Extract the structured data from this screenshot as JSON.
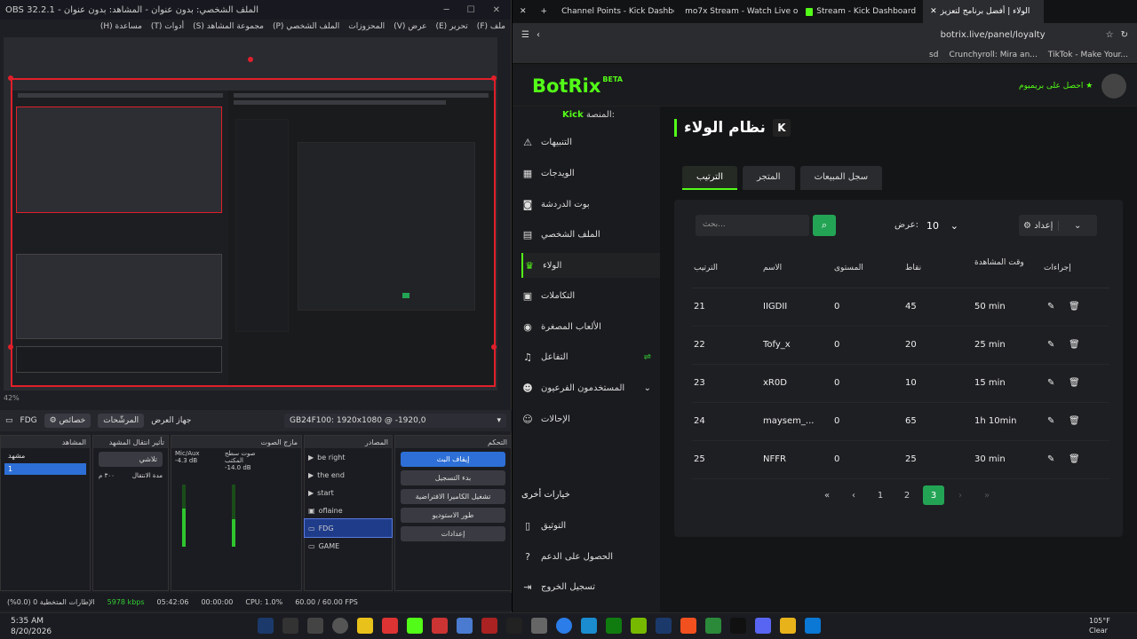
{
  "obs": {
    "title": "OBS 32.2.1 - الملف الشخصي: بدون عنوان - المشاهد: بدون عنوان",
    "menu": [
      "ملف (F)",
      "تحرير (E)",
      "عرض (V)",
      "المحزوزات",
      "الملف الشخصي (P)",
      "مجموعة المشاهد (S)",
      "أدوات (T)",
      "مساعدة (H)"
    ],
    "zoom": "42%",
    "source_name": "FDG",
    "properties_btn": "خصائص",
    "filters_btn": "المرشّحات",
    "device_label": "جهاز العرض",
    "device_value": "GB24F100: 1920x1080 @ -1920,0",
    "docks": {
      "scenes": "المشاهد",
      "transition": "تأثير انتقال المشهد",
      "mixer": "مازج الصوت",
      "sources": "المصادر",
      "controls": "التحكم"
    },
    "scenes": [
      "مشهد",
      "1"
    ],
    "transition_value": "تلاشي",
    "duration_label": "مدة الانتقال",
    "duration_value": "٣٠٠ م",
    "mixer": [
      {
        "name": "Mic/Aux",
        "db": "-4.3 dB",
        "level": 0.62
      },
      {
        "name": "صوت سطح المكتب",
        "db": "-14.0 dB",
        "level": 0.45
      }
    ],
    "sources": [
      "be right",
      "the end",
      "start",
      "oflaine",
      "FDG",
      "GAME"
    ],
    "controls": [
      "إيقاف البث",
      "بدء التسجيل",
      "تشغيل الكاميرا الافتراضية",
      "طور الاستوديو",
      "إعدادات"
    ],
    "status": {
      "dropped": "الإطارات المتخطية 0 (0.0%)",
      "kbps": "5978 kbps",
      "live": "05:42:06",
      "rec": "00:00:00",
      "cpu": "CPU: 1.0%",
      "fps": "60.00 / 60.00 FPS"
    }
  },
  "browser": {
    "tabs": [
      "Channel Points - Kick Dashbo",
      "mo7x Stream - Watch Live on",
      "Stream - Kick Dashboard",
      "الولاء | أفضل برنامج لتعزيز"
    ],
    "url": "botrix.live/panel/loyalty",
    "bookmarks": [
      "sd",
      "Crunchyroll: Mira an...",
      "TikTok - Make Your..."
    ]
  },
  "botrix": {
    "logo": "BotRix",
    "beta": "BETA",
    "premium": "احصل على بريميوم",
    "platform_label": "المنصة:",
    "platform_value": "Kick",
    "sidebar": [
      "التنبيهات",
      "الويدجات",
      "بوت الدردشة",
      "الملف الشخصي",
      "الولاء",
      "التكاملات",
      "الألعاب المصغرة",
      "التفاعل",
      "المستخدمون الفرعيون",
      "الإحالات"
    ],
    "other_options": "خيارات أخرى",
    "sidebar_bottom": [
      "التوثيق",
      "الحصول على الدعم",
      "تسجيل الخروج"
    ],
    "page_title": "نظام الولاء",
    "tabs": [
      "الترتيب",
      "المتجر",
      "سجل المبيعات"
    ],
    "search_placeholder": "بحث...",
    "show_label": "عرض:",
    "show_value": "10",
    "settings_btn": "إعداد",
    "columns": [
      "الترتيب",
      "الاسم",
      "المستوى",
      "نقاط",
      "وقت المشاهدة",
      "إجراءات"
    ],
    "rows": [
      {
        "rank": "21",
        "name": "IIGDII",
        "level": "0",
        "points": "45",
        "time": "50 min"
      },
      {
        "rank": "22",
        "name": "Tofy_x",
        "level": "0",
        "points": "20",
        "time": "25 min"
      },
      {
        "rank": "23",
        "name": "xR0D",
        "level": "0",
        "points": "10",
        "time": "15 min"
      },
      {
        "rank": "24",
        "name": "maysem_...",
        "level": "0",
        "points": "65",
        "time": "1h 10min"
      },
      {
        "rank": "25",
        "name": "NFFR",
        "level": "0",
        "points": "25",
        "time": "30 min"
      }
    ],
    "pages": [
      "1",
      "2",
      "3"
    ],
    "active_page": "3"
  },
  "taskbar": {
    "time": "5:35 AM",
    "date": "8/20/2026",
    "temp": "105°F",
    "weather": "Clear"
  }
}
